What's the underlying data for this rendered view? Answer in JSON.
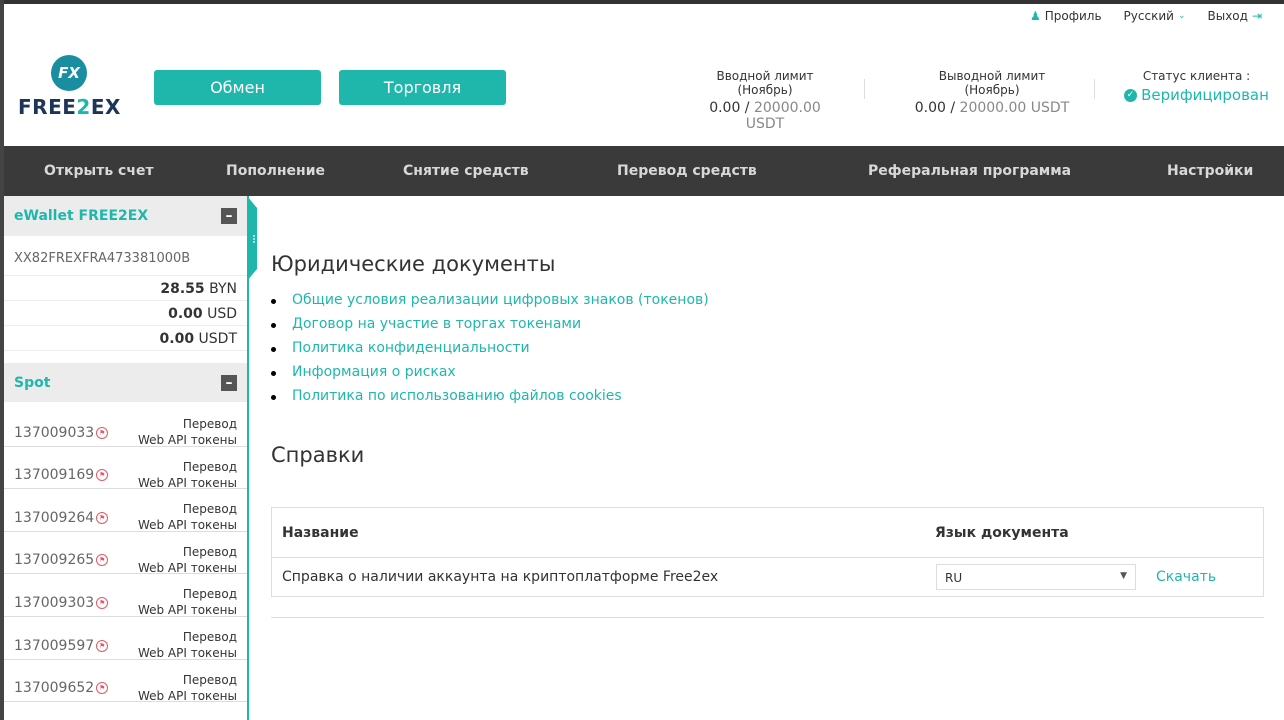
{
  "topbar": {
    "profile": "Профиль",
    "language": "Русский",
    "logout": "Выход"
  },
  "logo": {
    "mark": "FX",
    "text_a": "FREE",
    "text_b": "2",
    "text_c": "EX"
  },
  "header": {
    "btn_exchange": "Обмен",
    "btn_trade": "Торговля",
    "deposit_limit_label": "Вводной лимит (Ноябрь)",
    "deposit_limit_used": "0.00",
    "deposit_limit_total": "20000.00 USDT",
    "withdraw_limit_label": "Выводной лимит (Ноябрь)",
    "withdraw_limit_used": "0.00",
    "withdraw_limit_total": "20000.00 USDT",
    "sep": " / ",
    "status_label": "Статус клиента :",
    "status_value": "Верифицирован"
  },
  "nav": {
    "items": [
      "Открыть счет",
      "Пополнение",
      "Снятие средств",
      "Перевод средств",
      "Реферальная программа",
      "Настройки"
    ]
  },
  "sidebar": {
    "ewallet_title": "eWallet FREE2EX",
    "account": "XX82FREXFRA473381000B",
    "balances": [
      {
        "amount": "28.55",
        "currency": "BYN"
      },
      {
        "amount": "0.00",
        "currency": "USD"
      },
      {
        "amount": "0.00",
        "currency": "USDT"
      }
    ],
    "spot_title": "Spot",
    "spot_rows": [
      {
        "id": "137009033",
        "l1": "Перевод",
        "l2": "Web API токены"
      },
      {
        "id": "137009169",
        "l1": "Перевод",
        "l2": "Web API токены"
      },
      {
        "id": "137009264",
        "l1": "Перевод",
        "l2": "Web API токены"
      },
      {
        "id": "137009265",
        "l1": "Перевод",
        "l2": "Web API токены"
      },
      {
        "id": "137009303",
        "l1": "Перевод",
        "l2": "Web API токены"
      },
      {
        "id": "137009597",
        "l1": "Перевод",
        "l2": "Web API токены"
      },
      {
        "id": "137009652",
        "l1": "Перевод",
        "l2": "Web API токены"
      }
    ]
  },
  "main": {
    "legal_title": "Юридические документы",
    "legal_links": [
      "Общие условия реализации цифровых знаков (токенов)",
      "Договор на участие в торгах токенами",
      "Политика конфиденциальности",
      "Информация о рисках",
      "Политика по использованию файлов cookies"
    ],
    "certs_title": "Справки",
    "table": {
      "col_name": "Название",
      "col_lang": "Язык документа",
      "row_name": "Справка о наличии аккаунта на криптоплатформе Free2ex",
      "row_lang": "RU",
      "row_download": "Скачать"
    }
  },
  "colors": {
    "accent": "#1fb7ac",
    "nav_bg": "#3a3a3a",
    "brand_dark": "#1d3557"
  }
}
